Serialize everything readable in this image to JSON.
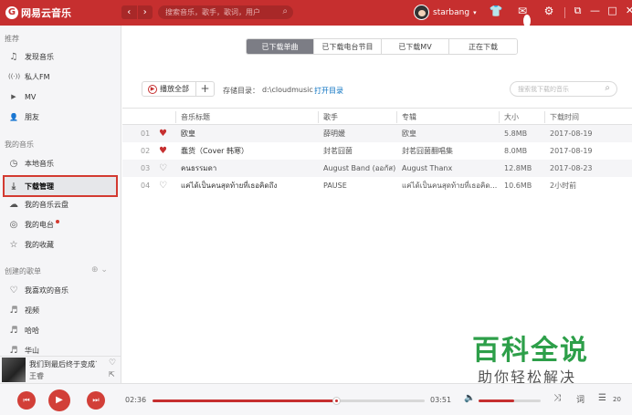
{
  "app": {
    "logo_text": "网易云音乐",
    "logo_glyph": "G"
  },
  "topbar": {
    "back": "‹",
    "forward": "›",
    "search_placeholder": "搜索音乐，歌手，歌词，用户",
    "search_icon": "search-icon",
    "username": "starbang",
    "caret": "▾",
    "notification_count": "1",
    "icons": [
      "skin-icon",
      "message-icon",
      "gear-icon"
    ],
    "window_icons": [
      "mini-mode-icon",
      "minimize-icon",
      "maximize-icon",
      "close-icon"
    ]
  },
  "sidebar": {
    "recommend_title": "推荐",
    "recommend": [
      {
        "label": "发现音乐",
        "icon": "♫"
      },
      {
        "label": "私人FM",
        "icon": "((·))"
      },
      {
        "label": "MV",
        "icon": "▶"
      },
      {
        "label": "朋友",
        "icon": "👤"
      }
    ],
    "my_music_title": "我的音乐",
    "my_music": [
      {
        "label": "本地音乐",
        "icon": "◷"
      },
      {
        "label": "下载管理",
        "icon": "⤓",
        "active": true
      },
      {
        "label": "我的音乐云盘",
        "icon": "☁"
      },
      {
        "label": "我的电台",
        "icon": "◎"
      },
      {
        "label": "我的收藏",
        "icon": "☆"
      }
    ],
    "created_title": "创建的歌单",
    "created_tools": "⊕ ⌄",
    "created": [
      {
        "label": "我喜欢的音乐",
        "icon": "♡"
      },
      {
        "label": "视频",
        "icon": "♬"
      },
      {
        "label": "哈哈",
        "icon": "♬"
      },
      {
        "label": "华山",
        "icon": "♬"
      }
    ]
  },
  "mini_player": {
    "title": "我们到最后终于变成了…",
    "artist": "王睿"
  },
  "tabs": [
    {
      "label": "已下载单曲",
      "active": true
    },
    {
      "label": "已下载电台节目",
      "active": false
    },
    {
      "label": "已下载MV",
      "active": false
    },
    {
      "label": "正在下载",
      "active": false
    }
  ],
  "toolbar": {
    "play_all": "播放全部",
    "add": "+",
    "store_label": "存储目录：",
    "store_path": "d:\\cloudmusic",
    "open_dir": "打开目录",
    "search_placeholder": "搜索我下载的音乐"
  },
  "table": {
    "headers": [
      "音乐标题",
      "歌手",
      "专辑",
      "大小",
      "下载时间"
    ],
    "rows": [
      {
        "idx": "01",
        "liked": true,
        "title": "欧皇",
        "artist": "薛明媛",
        "album": "欧皇",
        "size": "5.8MB",
        "time": "2017-08-19"
      },
      {
        "idx": "02",
        "liked": true,
        "title": "蠢货（Cover 韩寒）",
        "artist": "封茗囧菌",
        "album": "封茗囧菌翻唱集",
        "size": "8.0MB",
        "time": "2017-08-19"
      },
      {
        "idx": "03",
        "liked": false,
        "title": "คนธรรมดา",
        "artist": "August Band (ออกัส)",
        "album": "August Thanx",
        "size": "12.8MB",
        "time": "2017-08-23"
      },
      {
        "idx": "04",
        "liked": false,
        "title": "แค่ได้เป็นคนสุดท้ายที่เธอคิดถึง",
        "artist": "PAUSE",
        "album": "แค่ได้เป็นคนสุดท้ายที่เธอคิด...",
        "size": "10.6MB",
        "time": "2小时前"
      }
    ]
  },
  "watermark": {
    "title": "百科全说",
    "subtitle": "助你轻松解决"
  },
  "player": {
    "prev": "⏮",
    "play": "▶",
    "next": "⏭",
    "current_time": "02:36",
    "total_time": "03:51",
    "progress": 0.675,
    "volume": 0.58,
    "playlist_count": "20",
    "accent": "#c62f2f"
  }
}
